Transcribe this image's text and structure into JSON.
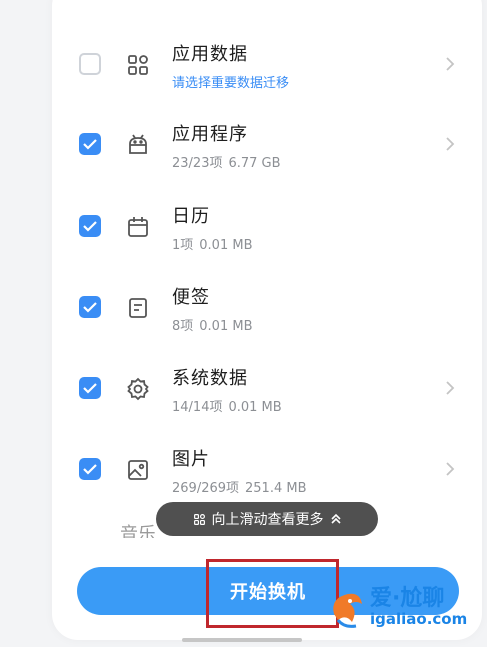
{
  "items": [
    {
      "title": "应用数据",
      "subtitle": "请选择重要数据迁移",
      "count": "",
      "size": "",
      "checked": false,
      "icon": "apps-grid-icon",
      "chevron": true,
      "link": true
    },
    {
      "title": "应用程序",
      "subtitle": "",
      "count": "23/23项",
      "size": "6.77 GB",
      "checked": true,
      "icon": "android-icon",
      "chevron": true,
      "link": false
    },
    {
      "title": "日历",
      "subtitle": "",
      "count": "1项",
      "size": "0.01 MB",
      "checked": true,
      "icon": "calendar-icon",
      "chevron": false,
      "link": false
    },
    {
      "title": "便签",
      "subtitle": "",
      "count": "8项",
      "size": "0.01 MB",
      "checked": true,
      "icon": "note-icon",
      "chevron": false,
      "link": false
    },
    {
      "title": "系统数据",
      "subtitle": "",
      "count": "14/14项",
      "size": "0.01 MB",
      "checked": true,
      "icon": "gear-icon",
      "chevron": true,
      "link": false
    },
    {
      "title": "图片",
      "subtitle": "",
      "count": "269/269项",
      "size": "251.4 MB",
      "checked": true,
      "icon": "image-icon",
      "chevron": true,
      "link": false
    }
  ],
  "peek_text": "音乐",
  "toast": {
    "text": "向上滑动查看更多"
  },
  "start_button": {
    "label": "开始换机"
  },
  "watermark": {
    "line1": "爱·尬聊",
    "line2": "igaliao.com"
  },
  "colors": {
    "accent": "#3a8df5",
    "highlight": "#c0272d"
  }
}
